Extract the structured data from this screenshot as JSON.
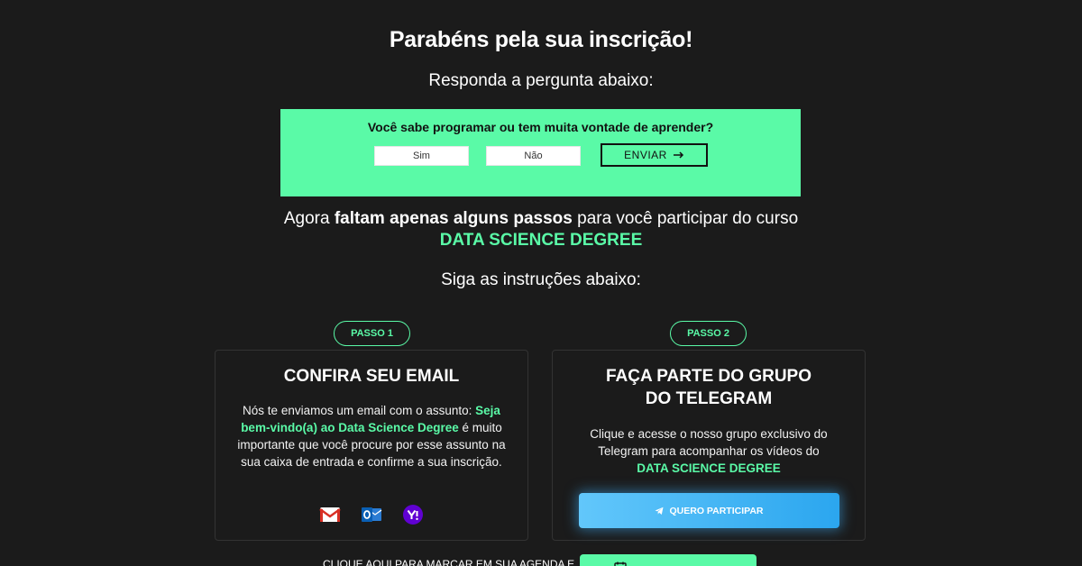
{
  "header": {
    "title": "Parabéns pela sua inscrição!",
    "subtitle": "Responda a pergunta abaixo:"
  },
  "survey": {
    "question": "Você sabe programar ou tem muita vontade de aprender?",
    "option_yes": "Sim",
    "option_no": "Não",
    "submit_label": "ENVIAR",
    "bg_color": "#5afaa7"
  },
  "intro": {
    "prefix": "Agora ",
    "bold": "faltam apenas alguns passos",
    "suffix": " para você participar do curso",
    "course_name": "DATA SCIENCE DEGREE",
    "instructions": "Siga as instruções abaixo:"
  },
  "step1": {
    "badge": "PASSO 1",
    "title": "CONFIRA SEU EMAIL",
    "text_prefix": "Nós te enviamos um email com o assunto: ",
    "text_highlight": "Seja bem-vindo(a) ao Data Science Degree",
    "text_suffix": " é muito importante que você procure por esse assunto na sua caixa de entrada e confirme a sua inscrição.",
    "icons": [
      "gmail-icon",
      "outlook-icon",
      "yahoo-icon"
    ]
  },
  "step2": {
    "badge": "PASSO 2",
    "title_line1": "FAÇA PARTE DO GRUPO",
    "title_line2": "DO TELEGRAM",
    "text": "Clique e acesse o nosso grupo exclusivo do Telegram para acompanhar os vídeos do",
    "highlight": "DATA SCIENCE DEGREE",
    "cta_label": "QUERO PARTICIPAR",
    "cta_color": "#2ba6ef"
  },
  "footer": {
    "text": "CLIQUE AQUI PARA MARCAR EM SUA AGENDA E"
  },
  "colors": {
    "background": "#1b1b1b",
    "accent": "#5afaa7"
  }
}
